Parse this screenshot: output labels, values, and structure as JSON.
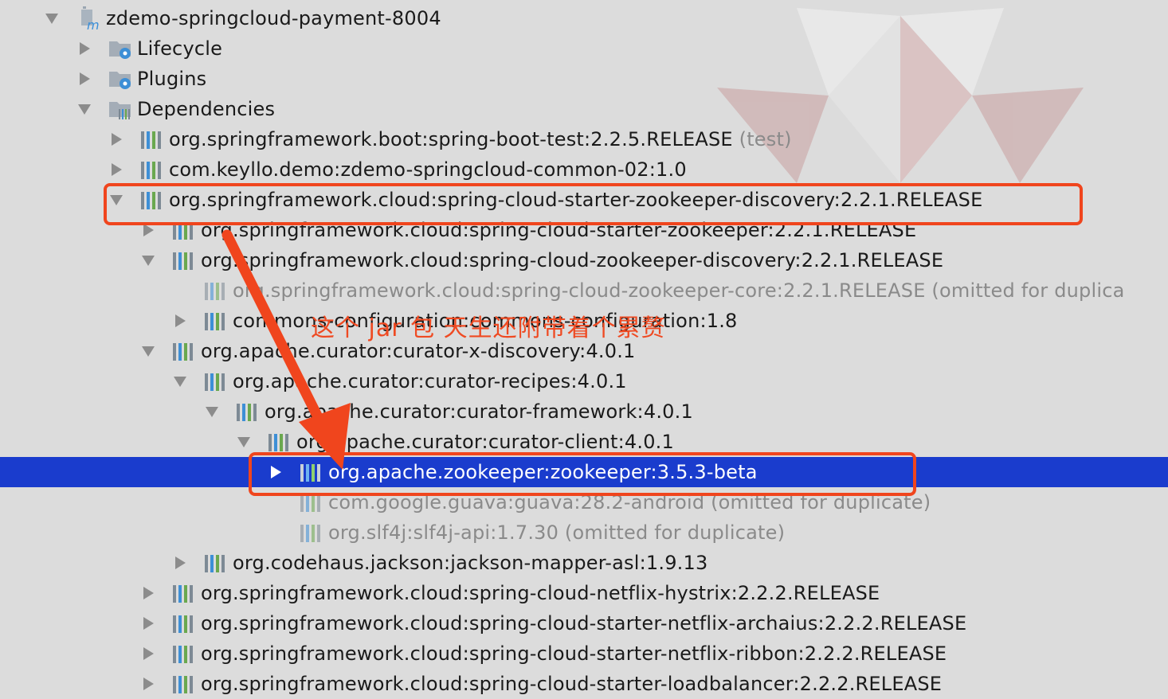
{
  "icons": {
    "expanded": "triangle-down-icon",
    "collapsed": "triangle-right-icon",
    "module": "maven-module-icon",
    "folder": "maven-folder-icon",
    "library": "library-bars-icon"
  },
  "colors": {
    "selection": "#1a3ccd",
    "annotation": "#f0451d",
    "dim_text": "#8a8a8a",
    "background": "#dcdcdc"
  },
  "tree": {
    "items": [
      {
        "label": "zdemo-springcloud-payment-8004",
        "suffix": "",
        "expanded": true,
        "icon": "module"
      },
      {
        "label": "Lifecycle",
        "suffix": "",
        "expanded": false,
        "icon": "folder"
      },
      {
        "label": "Plugins",
        "suffix": "",
        "expanded": false,
        "icon": "folder"
      },
      {
        "label": "Dependencies",
        "suffix": "",
        "expanded": true,
        "icon": "folder"
      },
      {
        "label": "org.springframework.boot:spring-boot-test:2.2.5.RELEASE",
        "suffix": " (test)",
        "expanded": false,
        "icon": "library"
      },
      {
        "label": "com.keyllo.demo:zdemo-springcloud-common-02:1.0",
        "suffix": "",
        "expanded": false,
        "icon": "library"
      },
      {
        "label": "org.springframework.cloud:spring-cloud-starter-zookeeper-discovery:2.2.1.RELEASE",
        "suffix": "",
        "expanded": true,
        "icon": "library"
      },
      {
        "label": "org.springframework.cloud:spring-cloud-starter-zookeeper:2.2.1.RELEASE",
        "suffix": "",
        "expanded": false,
        "icon": "library"
      },
      {
        "label": "org.springframework.cloud:spring-cloud-zookeeper-discovery:2.2.1.RELEASE",
        "suffix": "",
        "expanded": true,
        "icon": "library"
      },
      {
        "label": "org.springframework.cloud:spring-cloud-zookeeper-core:2.2.1.RELEASE",
        "suffix": " (omitted for duplica",
        "expanded": null,
        "icon": "library"
      },
      {
        "label": "commons-configuration:commons-configuration:1.8",
        "suffix": "",
        "expanded": false,
        "icon": "library"
      },
      {
        "label": "org.apache.curator:curator-x-discovery:4.0.1",
        "suffix": "",
        "expanded": true,
        "icon": "library"
      },
      {
        "label": "org.apache.curator:curator-recipes:4.0.1",
        "suffix": "",
        "expanded": true,
        "icon": "library"
      },
      {
        "label": "org.apache.curator:curator-framework:4.0.1",
        "suffix": "",
        "expanded": true,
        "icon": "library"
      },
      {
        "label": "org.apache.curator:curator-client:4.0.1",
        "suffix": "",
        "expanded": true,
        "icon": "library"
      },
      {
        "label": "org.apache.zookeeper:zookeeper:3.5.3-beta",
        "suffix": "",
        "expanded": false,
        "icon": "library",
        "selected": true
      },
      {
        "label": "com.google.guava:guava:28.2-android",
        "suffix": " (omitted for duplicate)",
        "expanded": null,
        "icon": "library"
      },
      {
        "label": "org.slf4j:slf4j-api:1.7.30",
        "suffix": " (omitted for duplicate)",
        "expanded": null,
        "icon": "library"
      },
      {
        "label": "org.codehaus.jackson:jackson-mapper-asl:1.9.13",
        "suffix": "",
        "expanded": false,
        "icon": "library"
      },
      {
        "label": "org.springframework.cloud:spring-cloud-netflix-hystrix:2.2.2.RELEASE",
        "suffix": "",
        "expanded": false,
        "icon": "library"
      },
      {
        "label": "org.springframework.cloud:spring-cloud-starter-netflix-archaius:2.2.2.RELEASE",
        "suffix": "",
        "expanded": false,
        "icon": "library"
      },
      {
        "label": "org.springframework.cloud:spring-cloud-starter-netflix-ribbon:2.2.2.RELEASE",
        "suffix": "",
        "expanded": false,
        "icon": "library"
      },
      {
        "label": "org.springframework.cloud:spring-cloud-starter-loadbalancer:2.2.2.RELEASE",
        "suffix": "",
        "expanded": false,
        "icon": "library"
      }
    ]
  },
  "annotation": {
    "text": "这个 jar 包 天生还附带着个累赘"
  }
}
